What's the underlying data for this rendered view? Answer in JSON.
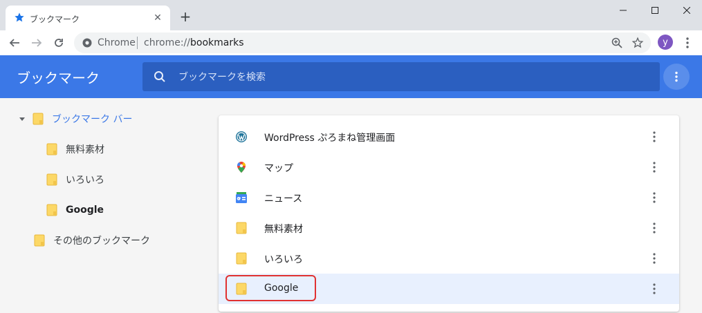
{
  "browser": {
    "tab_title": "ブックマーク",
    "omnibox_site": "Chrome",
    "omnibox_scheme": "chrome://",
    "omnibox_host": "bookmarks",
    "avatar_letter": "y"
  },
  "app": {
    "title": "ブックマーク",
    "search_placeholder": "ブックマークを検索"
  },
  "sidebar": {
    "items": [
      {
        "label": "ブックマーク バー"
      },
      {
        "label": "無料素材"
      },
      {
        "label": "いろいろ"
      },
      {
        "label": "Google"
      },
      {
        "label": "その他のブックマーク"
      }
    ]
  },
  "list": {
    "items": [
      {
        "label": "WordPress ぷろまね管理画面",
        "icon": "wordpress-icon"
      },
      {
        "label": "マップ",
        "icon": "maps-pin-icon"
      },
      {
        "label": "ニュース",
        "icon": "google-news-icon"
      },
      {
        "label": "無料素材",
        "icon": "folder-icon"
      },
      {
        "label": "いろいろ",
        "icon": "folder-icon"
      },
      {
        "label": "Google",
        "icon": "folder-icon"
      }
    ]
  },
  "colors": {
    "accent": "#3b78e7",
    "highlight": "#e03131",
    "folder": "#fcd867"
  }
}
